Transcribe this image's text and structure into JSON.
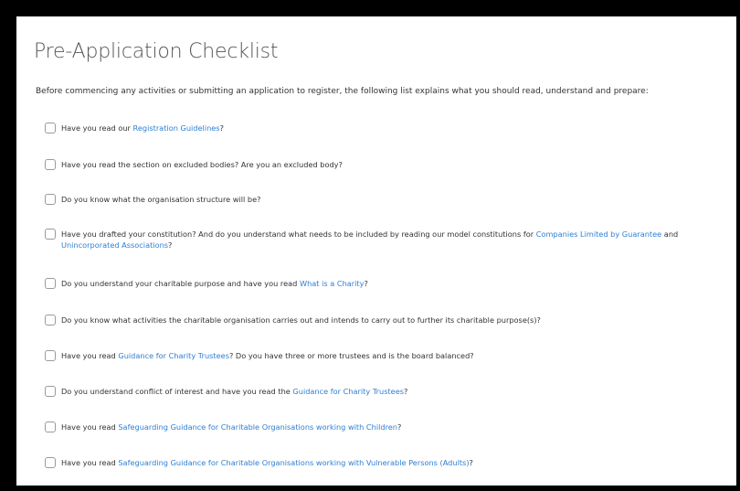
{
  "page": {
    "title": "Pre-Application Checklist",
    "intro": "Before commencing any activities or submitting an application to register, the following list explains what you should read, understand and prepare:"
  },
  "items": [
    {
      "a": "Have you read our ",
      "link1": "Registration Guidelines",
      "b": "?"
    },
    {
      "a": "Have you read the section on excluded bodies? Are you an excluded body?"
    },
    {
      "a": "Do you know what the organisation structure will be?"
    },
    {
      "a": "Have you drafted your constitution? And do you understand what needs to be included by reading our model constitutions for ",
      "link1": "Companies Limited by Guarantee",
      "b": " and ",
      "link2": "Unincorporated Associations",
      "c": "?"
    },
    {
      "a": "Do you understand your charitable purpose and have you read ",
      "link1": "What is a Charity",
      "b": "?"
    },
    {
      "a": "Do you know what activities the charitable organisation carries out and intends to carry out to further its charitable purpose(s)?"
    },
    {
      "a": "Have you read ",
      "link1": "Guidance for Charity Trustees",
      "b": "? Do you have three or more trustees and is the board balanced?"
    },
    {
      "a": "Do you understand conflict of interest and have you read the ",
      "link1": "Guidance for Charity Trustees",
      "b": "?"
    },
    {
      "a": "Have you read ",
      "link1": "Safeguarding Guidance for Charitable Organisations working with Children",
      "b": "?"
    },
    {
      "a": "Have you read ",
      "link1": "Safeguarding Guidance for Charitable Organisations working with Vulnerable Persons (Adults)",
      "b": "?"
    }
  ],
  "colors": {
    "link": "#2d7fd3",
    "text": "#333333",
    "title": "#555555",
    "frame": "#000000"
  }
}
